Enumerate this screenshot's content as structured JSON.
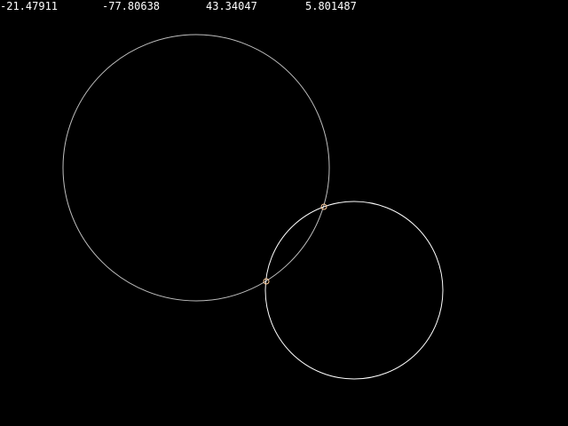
{
  "readouts": [
    "-21.47911",
    "-77.80638",
    "43.34047",
    "5.801487"
  ],
  "colors": {
    "background": "#000000",
    "text": "#ffffff",
    "circle_large": "#bfbfbf",
    "circle_small": "#ffffff",
    "intersection_marker": "#ffcc99"
  }
}
